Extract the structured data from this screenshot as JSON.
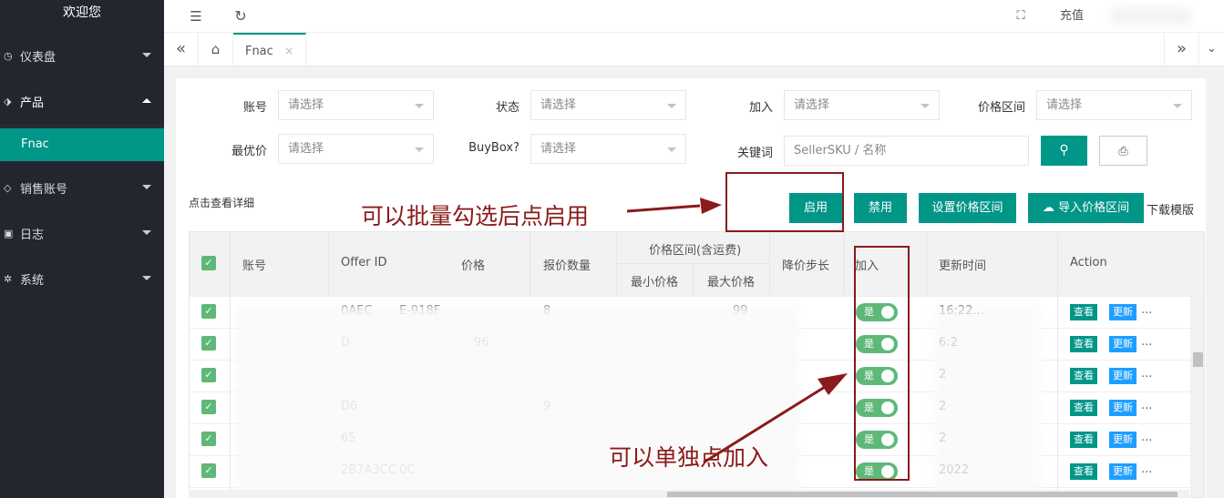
{
  "sidebar": {
    "welcome": "欢迎您",
    "items": [
      {
        "label": "仪表盘",
        "icon": "dashboard-icon"
      },
      {
        "label": "产品",
        "icon": "tag-icon"
      },
      {
        "label": "销售账号",
        "icon": "diamond-icon"
      },
      {
        "label": "日志",
        "icon": "log-icon"
      },
      {
        "label": "系统",
        "icon": "gear-icon"
      }
    ],
    "sub_active": "Fnac"
  },
  "topbar": {
    "recharge": "充值"
  },
  "tabs": {
    "active": "Fnac",
    "close": "×"
  },
  "filters": {
    "account": "账号",
    "status": "状态",
    "join": "加入",
    "price_range": "价格区间",
    "best_price": "最优价",
    "buybox": "BuyBox?",
    "keyword": "关键词",
    "select_placeholder": "请选择",
    "keyword_placeholder": "SellerSKU / 名称"
  },
  "actions": {
    "hint": "点击查看详细",
    "enable": "启用",
    "disable": "禁用",
    "set_range": "设置价格区间",
    "import_range": "导入价格区间",
    "download": "下载模版"
  },
  "annotations": {
    "batch": "可以批量勾选后点启用",
    "single": "可以单独点加入"
  },
  "table": {
    "headers": {
      "account": "账号",
      "offer_id": "Offer ID",
      "price": "价格",
      "qty": "报价数量",
      "range_group": "价格区间(含运费)",
      "min": "最小价格",
      "max": "最大价格",
      "step": "降价步长",
      "join": "加入",
      "updated": "更新时间",
      "action": "Action"
    },
    "rows": [
      {
        "offer": "0AEC",
        "offer2": "E-918F",
        "price": "",
        "qty": "8",
        "max": "99",
        "updated": "16:22...",
        "on": "是"
      },
      {
        "offer": "D",
        "offer2": "",
        "price": "96",
        "qty": "",
        "max": "",
        "updated": "6:2",
        "on": "是"
      },
      {
        "offer": "",
        "offer2": "",
        "price": "",
        "qty": "",
        "max": "",
        "updated": "2",
        "on": "是"
      },
      {
        "offer": "D6",
        "offer2": "",
        "price": "",
        "qty": "9",
        "max": "",
        "updated": "2",
        "on": "是"
      },
      {
        "offer": "65",
        "offer2": "",
        "price": "",
        "qty": "",
        "max": "",
        "updated": "2",
        "on": "是"
      },
      {
        "offer": "2B7A3CC",
        "offer2": "0C",
        "price": "",
        "qty": "",
        "max": "",
        "updated": "2022",
        "on": "是"
      }
    ],
    "view": "查看",
    "update": "更新",
    "more": "..."
  }
}
